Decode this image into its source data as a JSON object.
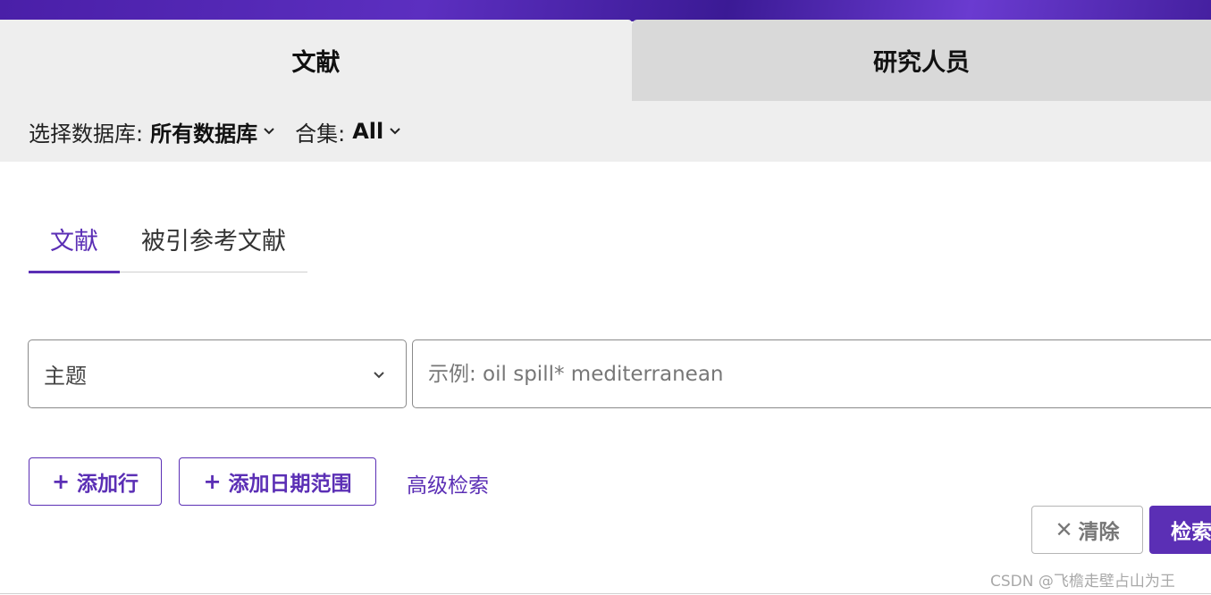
{
  "main_tabs": [
    {
      "label": "文献",
      "active": true
    },
    {
      "label": "研究人员",
      "active": false
    }
  ],
  "database_bar": {
    "db_label": "选择数据库:",
    "db_value": "所有数据库",
    "collection_label": "合集:",
    "collection_value": "All"
  },
  "sub_tabs": [
    {
      "label": "文献",
      "active": true
    },
    {
      "label": "被引参考文献",
      "active": false
    }
  ],
  "search_row": {
    "field_value": "主题",
    "placeholder": "示例: oil spill* mediterranean"
  },
  "actions": {
    "add_row": "添加行",
    "add_date_range": "添加日期范围",
    "advanced_search": "高级检索",
    "clear": "清除",
    "search": "检索"
  },
  "watermark": "CSDN @飞檐走壁占山为王",
  "colors": {
    "accent": "#5b2fb5",
    "banner": "#4a1fa8",
    "tab_active_bg": "#eeeeee",
    "tab_inactive_bg": "#d9d9d9"
  },
  "icons": {
    "chevron": "chevron-down-icon",
    "plus": "plus-icon",
    "close": "close-icon"
  }
}
